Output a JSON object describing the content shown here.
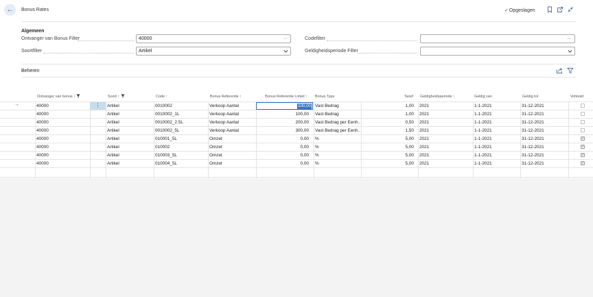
{
  "header": {
    "back_icon": "arrow-left-icon",
    "title": "Bonus Rates",
    "saved_label": "Opgeslagen",
    "icons": [
      "bookmark-icon",
      "open-new-window-icon",
      "collapse-icon"
    ]
  },
  "general": {
    "section_title": "Algemeen",
    "fields": {
      "receiver_filter": {
        "label": "Ontvanger van Bonus Filter",
        "value": "40000",
        "button": "···"
      },
      "type_filter": {
        "label": "Soortfilter",
        "value": "Artikel"
      },
      "code_filter": {
        "label": "Codefilter",
        "value": "",
        "button": "···"
      },
      "period_filter": {
        "label": "Geldigheidsperiode Filter",
        "value": ""
      }
    }
  },
  "part": {
    "title": "Beheren",
    "icons": [
      "share-icon",
      "filter-icon"
    ]
  },
  "table": {
    "columns": {
      "receiver": "Ontvanger van bonus ↑",
      "type": "Soort ↑",
      "code": "Code ↑",
      "reference": "Bonus Referentie ↑",
      "limit": "Bonus Referentie Limiet ↑",
      "bonus_type": "Bonus Type",
      "rate": "Tarief",
      "period": "Geldigheidsperiode ↑",
      "valid_from": "Geldig van",
      "valid_to": "Geldig tot",
      "completed": "Voltooid"
    },
    "rows": [
      {
        "receiver": "40000",
        "type": "Artikel",
        "code": "0010002",
        "reference": "Verkoop Aantal",
        "limit": "100,00",
        "bonus_type": "Vast Bedrag",
        "rate": "1,00",
        "period": "2021",
        "valid_from": "1-1-2021",
        "valid_to": "31-12-2021",
        "completed": false
      },
      {
        "receiver": "40000",
        "type": "Artikel",
        "code": "0010002_1L",
        "reference": "Verkoop Aantal",
        "limit": "100,00",
        "bonus_type": "Vast Bedrag",
        "rate": "1,00",
        "period": "2021",
        "valid_from": "1-1-2021",
        "valid_to": "31-12-2021",
        "completed": false
      },
      {
        "receiver": "40000",
        "type": "Artikel",
        "code": "0010002_2.5L",
        "reference": "Verkoop Aantal",
        "limit": "200,00",
        "bonus_type": "Vast Bedrag per Eenh...",
        "rate": "0,50",
        "period": "2021",
        "valid_from": "1-1-2021",
        "valid_to": "31-12-2021",
        "completed": false
      },
      {
        "receiver": "40000",
        "type": "Artikel",
        "code": "0010002_5L",
        "reference": "Verkoop Aantal",
        "limit": "300,00",
        "bonus_type": "Vast Bedrag per Eenh...",
        "rate": "1,50",
        "period": "2021",
        "valid_from": "1-1-2021",
        "valid_to": "31-12-2021",
        "completed": false
      },
      {
        "receiver": "40000",
        "type": "Artikel",
        "code": "010001_5L",
        "reference": "Omzet",
        "limit": "0,00",
        "bonus_type": "%",
        "rate": "5,00",
        "period": "2021",
        "valid_from": "1-1-2021",
        "valid_to": "31-12-2021",
        "completed": true
      },
      {
        "receiver": "40000",
        "type": "Artikel",
        "code": "010002",
        "reference": "Omzet",
        "limit": "0,00",
        "bonus_type": "%",
        "rate": "5,00",
        "period": "2021",
        "valid_from": "1-1-2021",
        "valid_to": "31-12-2021",
        "completed": true
      },
      {
        "receiver": "40000",
        "type": "Artikel",
        "code": "010003_5L",
        "reference": "Omzet",
        "limit": "0,00",
        "bonus_type": "%",
        "rate": "5,00",
        "period": "2021",
        "valid_from": "1-1-2021",
        "valid_to": "31-12-2021",
        "completed": true
      },
      {
        "receiver": "40000",
        "type": "Artikel",
        "code": "010004_5L",
        "reference": "Omzet",
        "limit": "0,00",
        "bonus_type": "%",
        "rate": "5,00",
        "period": "2021",
        "valid_from": "1-1-2021",
        "valid_to": "31-12-2021",
        "completed": true
      }
    ]
  },
  "colors": {
    "accent": "#2e6fc0",
    "selected_cell": "#c8ddeb",
    "background": "#f3f3f3"
  }
}
